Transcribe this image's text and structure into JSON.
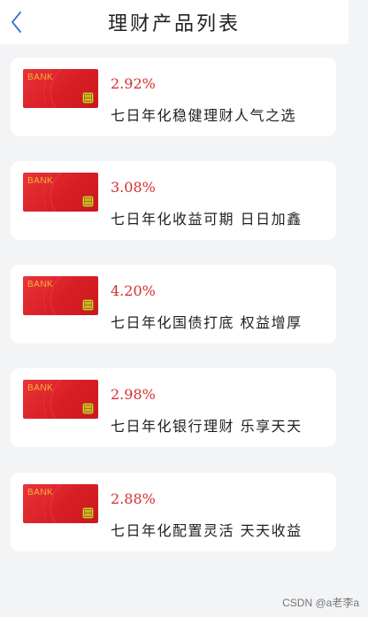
{
  "header": {
    "title": "理财产品列表"
  },
  "products": [
    {
      "card_text": "BANK",
      "rate": "2.92%",
      "desc": "七日年化稳健理财人气之选"
    },
    {
      "card_text": "BANK",
      "rate": "3.08%",
      "desc": "七日年化收益可期 日日加鑫"
    },
    {
      "card_text": "BANK",
      "rate": "4.20%",
      "desc": "七日年化国债打底 权益增厚"
    },
    {
      "card_text": "BANK",
      "rate": "2.98%",
      "desc": "七日年化银行理财 乐享天天"
    },
    {
      "card_text": "BANK",
      "rate": "2.88%",
      "desc": "七日年化配置灵活 天天收益"
    }
  ],
  "watermark": "CSDN @a老李a",
  "colors": {
    "accent": "#d62d2d",
    "back": "#3b6fd8",
    "card_red": "#d81e24"
  }
}
